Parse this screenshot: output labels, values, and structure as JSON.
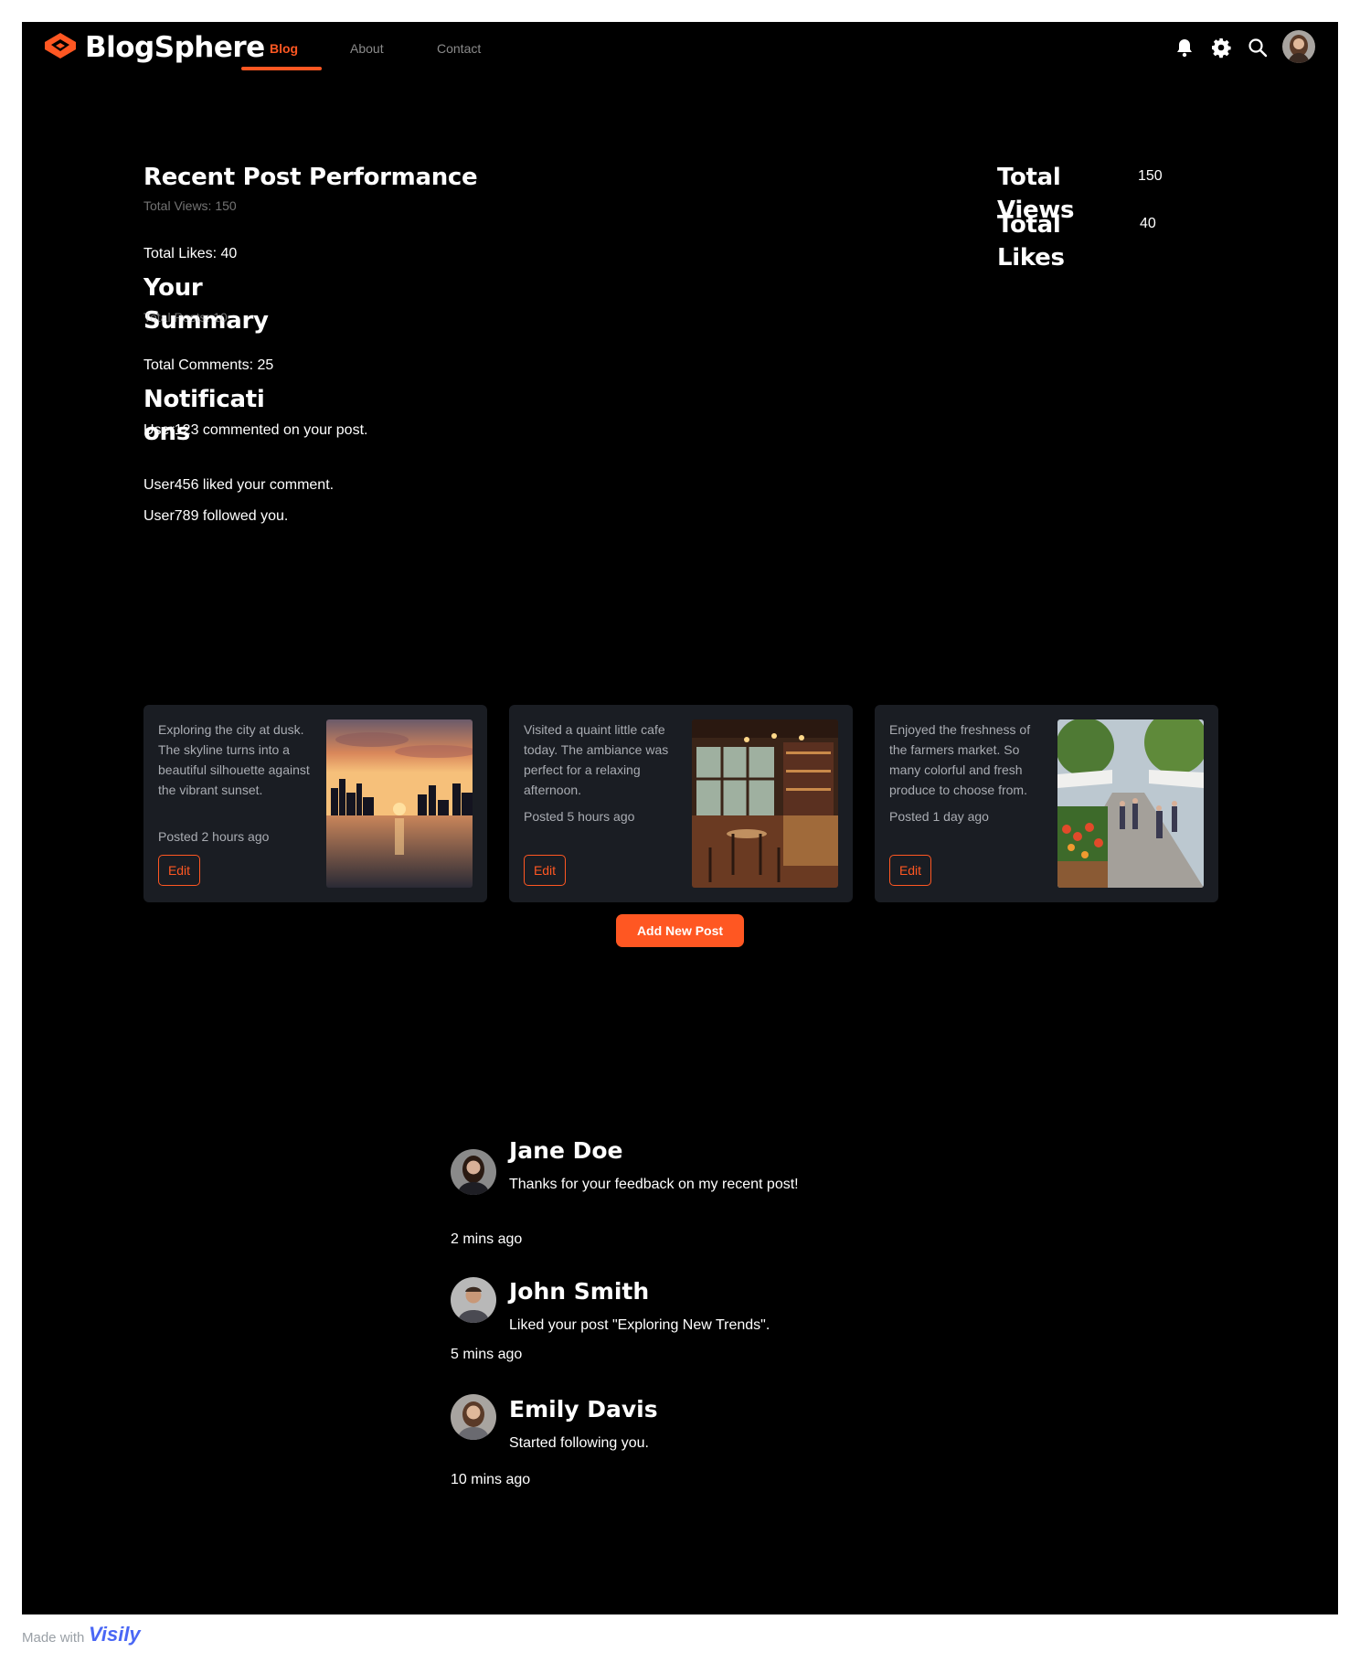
{
  "app": {
    "brand": "BlogSphere",
    "accent_color": "#ff5722"
  },
  "nav": {
    "tabs": [
      {
        "label": "Blog",
        "active": true
      },
      {
        "label": "About",
        "active": false
      },
      {
        "label": "Contact",
        "active": false
      }
    ],
    "icons": [
      "bell-icon",
      "gear-icon",
      "search-icon",
      "user-avatar"
    ]
  },
  "stats": {
    "recent_post_heading": "Recent Post Performance",
    "recent_post_overlap_text": "Total Views: 150",
    "recent_post_likes": "Total Likes: 40",
    "summary_heading": "Your Summary",
    "summary_overlap_text": "Total Posts: 10",
    "summary_comments": "Total Comments: 25",
    "views_label": "Total Views",
    "views_value": "150",
    "likes_label": "Total Likes",
    "likes_value": "40"
  },
  "notifications": {
    "heading": "Notifications",
    "items": [
      "User123 commented on your post.",
      "User456 liked your comment.",
      "User789 followed you."
    ]
  },
  "posts": [
    {
      "text": "Exploring the city at dusk. The skyline turns into a beautiful silhouette against the vibrant sunset.",
      "posted": "Posted 2 hours ago",
      "edit_label": "Edit",
      "image": "city-skyline-sunset"
    },
    {
      "text": "Visited a quaint little cafe today. The ambiance was perfect for a relaxing afternoon.",
      "posted": "Posted 5 hours ago",
      "edit_label": "Edit",
      "image": "cafe-interior"
    },
    {
      "text": "Enjoyed the freshness of the farmers market. So many colorful and fresh produce to choose from.",
      "posted": "Posted 1 day ago",
      "edit_label": "Edit",
      "image": "farmers-market"
    }
  ],
  "add_post_label": "Add New Post",
  "comments": [
    {
      "name": "Jane Doe",
      "text": "Thanks for your feedback on my recent post!",
      "time": "2 mins ago"
    },
    {
      "name": "John Smith",
      "text": "Liked your post \"Exploring New Trends\".",
      "time": "5 mins ago"
    },
    {
      "name": "Emily Davis",
      "text": "Started following you.",
      "time": "10 mins ago"
    }
  ],
  "footer": {
    "made_with": "Made with",
    "visily": "Visily"
  }
}
